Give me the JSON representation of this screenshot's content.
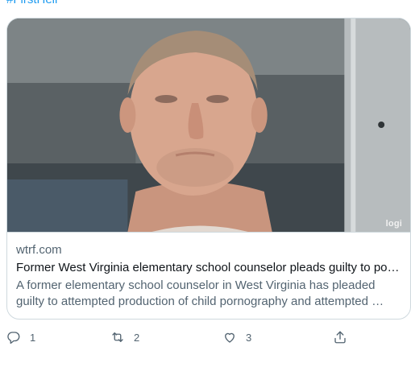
{
  "tweet": {
    "hashtag": "#FirstHell",
    "card": {
      "image_alt": "mugshot photo",
      "watermark": "logi",
      "domain": "wtrf.com",
      "headline": "Former West Virginia elementary school counselor pleads guilty to por…",
      "description": "A former elementary school counselor in West Virginia has pleaded guilty to attempted production of child pornography and attempted …"
    },
    "actions": {
      "reply": {
        "icon": "reply-icon",
        "count": "1"
      },
      "retweet": {
        "icon": "retweet-icon",
        "count": "2"
      },
      "like": {
        "icon": "like-icon",
        "count": "3"
      },
      "share": {
        "icon": "share-icon"
      }
    }
  },
  "colors": {
    "link": "#1d9bf0",
    "secondary_text": "#536471",
    "primary_text": "#0f1419",
    "border": "#cfd9de"
  }
}
